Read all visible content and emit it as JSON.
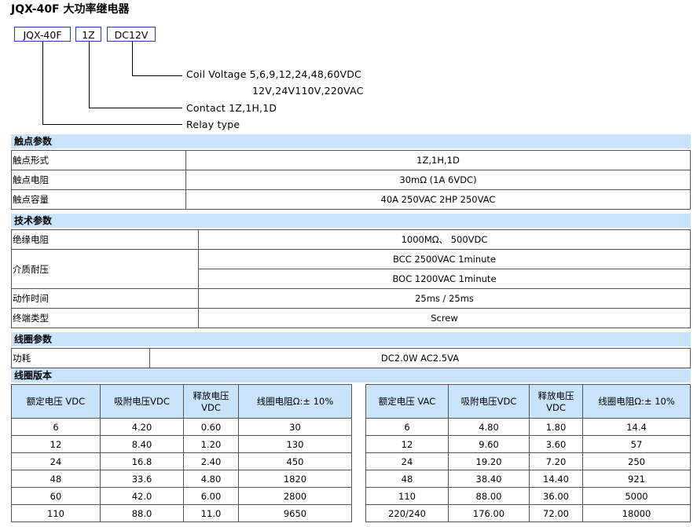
{
  "title": "JQX-40F 大功率继电器",
  "code": {
    "model": "JQX-40F",
    "contact": "1Z",
    "voltage": "DC12V"
  },
  "legend": {
    "coil_voltage_line1": "Coil Voltage 5,6,9,12,24,48,60VDC",
    "coil_voltage_line2": "12V,24V110V,220VAC",
    "contact": "Contact   1Z,1H,1D",
    "relay_type": "Relay type"
  },
  "sections": {
    "contact": "触点参数",
    "tech": "技术参数",
    "coil": "线圈参数",
    "coil_version": "线圈版本"
  },
  "contact_params": [
    {
      "key": "触点形式",
      "value": "1Z,1H,1D"
    },
    {
      "key": "触点电阻",
      "value": "30mΩ (1A 6VDC)"
    },
    {
      "key": "触点容量",
      "value": "40A 250VAC 2HP 250VAC"
    }
  ],
  "tech_params": {
    "insulation": {
      "key": "绝缘电阻",
      "value": "1000MΩ、 500VDC"
    },
    "dielectric": {
      "key": "介质耐压",
      "value1": "BCC 2500VAC 1minute",
      "value2": "BOC 1200VAC 1minute"
    },
    "operate_time": {
      "key": "动作时间",
      "value": "25ms / 25ms"
    },
    "terminal": {
      "key": "终端类型",
      "value": "Screw"
    }
  },
  "coil_params": {
    "key": "功耗",
    "value": "DC2.0W AC2.5VA"
  },
  "dc_table": {
    "headers": [
      "额定电压 VDC",
      "吸附电压VDC",
      "释放电压VDC",
      "线圈电阻Ω:± 10%"
    ],
    "rows": [
      [
        "6",
        "4.20",
        "0.60",
        "30"
      ],
      [
        "12",
        "8.40",
        "1.20",
        "130"
      ],
      [
        "24",
        "16.8",
        "2.40",
        "450"
      ],
      [
        "48",
        "33.6",
        "4.80",
        "1820"
      ],
      [
        "60",
        "42.0",
        "6.00",
        "2800"
      ],
      [
        "110",
        "88.0",
        "11.0",
        "9650"
      ]
    ]
  },
  "ac_table": {
    "headers": [
      "额定电压 VAC",
      "吸附电压VDC",
      "释放电压VDC",
      "线圈电阻Ω:± 10%"
    ],
    "rows": [
      [
        "6",
        "4.80",
        "1.80",
        "14.4"
      ],
      [
        "12",
        "9.60",
        "3.60",
        "57"
      ],
      [
        "24",
        "19.20",
        "7.20",
        "250"
      ],
      [
        "48",
        "38.40",
        "14.40",
        "921"
      ],
      [
        "110",
        "88.00",
        "36.00",
        "5000"
      ],
      [
        "220/240",
        "176.00",
        "72.00",
        "18000"
      ]
    ]
  }
}
